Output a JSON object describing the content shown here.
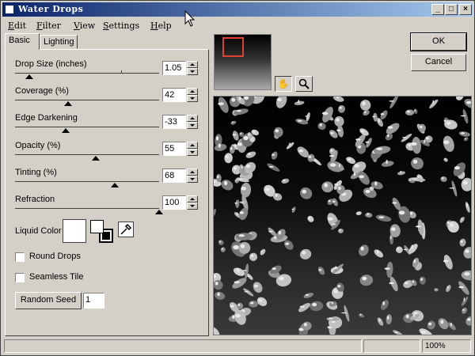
{
  "window": {
    "title": "Water Drops",
    "minimize_glyph": "_",
    "maximize_glyph": "□",
    "close_glyph": "×"
  },
  "menu": [
    {
      "label": "Edit"
    },
    {
      "label": "Filter"
    },
    {
      "label": "View"
    },
    {
      "label": "Settings"
    },
    {
      "label": "Help"
    }
  ],
  "tabs": {
    "basic": "Basic",
    "lighting": "Lighting"
  },
  "params": [
    {
      "label": "Drop Size (inches)",
      "value": "1.05",
      "slider_fraction": 0.1
    },
    {
      "label": "Coverage (%)",
      "value": "42",
      "slider_fraction": 0.37
    },
    {
      "label": "Edge Darkening",
      "value": "-33",
      "slider_fraction": 0.35
    },
    {
      "label": "Opacity (%)",
      "value": "55",
      "slider_fraction": 0.56
    },
    {
      "label": "Tinting (%)",
      "value": "68",
      "slider_fraction": 0.69
    },
    {
      "label": "Refraction",
      "value": "100",
      "slider_fraction": 1.0
    }
  ],
  "liquid_color": {
    "label": "Liquid Color",
    "color": "#ffffff"
  },
  "options": {
    "round_drops": {
      "label": "Round Drops",
      "checked": false
    },
    "seamless_tile": {
      "label": "Seamless Tile",
      "checked": false
    }
  },
  "random_seed": {
    "button_label": "Random Seed",
    "value": "1"
  },
  "buttons": {
    "ok": "OK",
    "cancel": "Cancel"
  },
  "tools": {
    "hand_icon": "hand-icon",
    "zoom_icon": "magnifier-icon"
  },
  "status": {
    "zoom": "100%"
  },
  "colors": {
    "title_start": "#0a246a",
    "title_end": "#a6caf0",
    "viewport_box": "#e04030"
  }
}
